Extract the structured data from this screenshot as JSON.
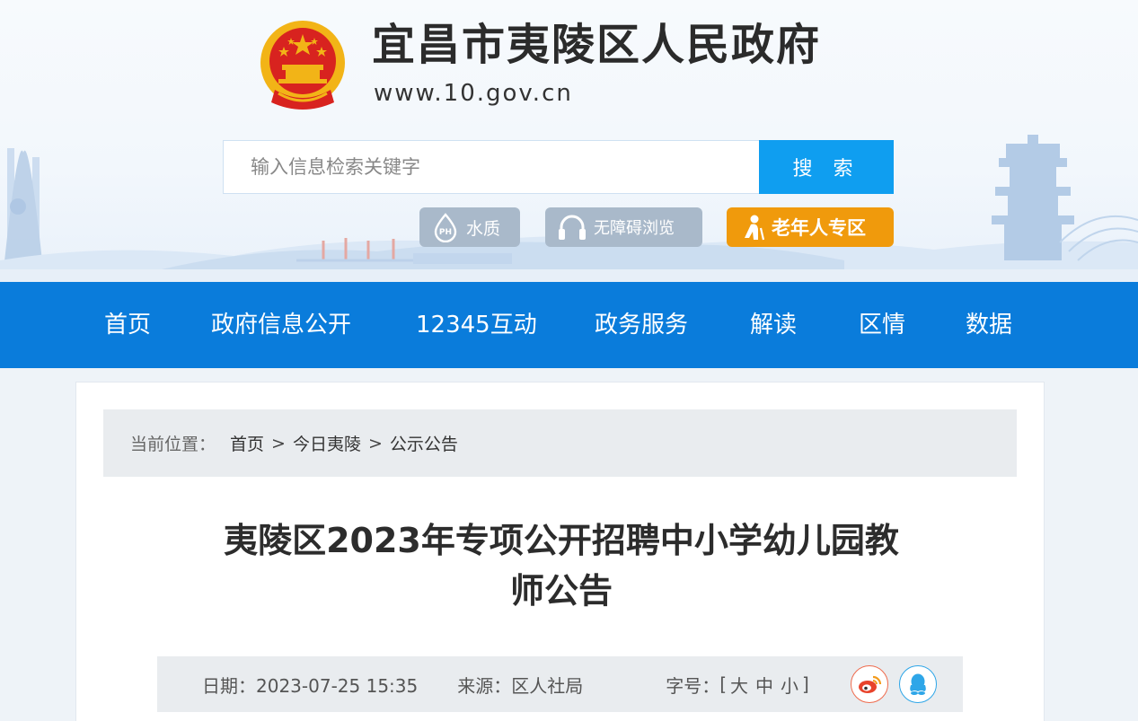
{
  "header": {
    "site_title": "宜昌市夷陵区人民政府",
    "site_url": "www.10.gov.cn",
    "search": {
      "placeholder": "输入信息检索关键字",
      "button_label": "搜 索"
    },
    "quick_links": [
      {
        "label": "水质",
        "icon": "ph-water-icon"
      },
      {
        "label": "无障碍浏览",
        "icon": "headphones-icon"
      },
      {
        "label": "老年人专区",
        "icon": "elderly-person-icon"
      }
    ]
  },
  "nav": {
    "items": [
      {
        "label": "首页"
      },
      {
        "label": "政府信息公开"
      },
      {
        "label": "12345互动"
      },
      {
        "label": "政务服务"
      },
      {
        "label": "解读"
      },
      {
        "label": "区情"
      },
      {
        "label": "数据"
      }
    ]
  },
  "breadcrumb": {
    "prefix": "当前位置：",
    "separator": ">",
    "items": [
      "首页",
      "今日夷陵",
      "公示公告"
    ]
  },
  "article": {
    "title_line1": "夷陵区2023年专项公开招聘中小学幼儿园教",
    "title_line2": "师公告",
    "meta": {
      "date_label": "日期：",
      "date": "2023-07-25 15:35",
      "source_label": "来源：",
      "source": "区人社局",
      "fontsize_label": "字号：",
      "fontsize_open": "[",
      "fontsize_options": [
        "大",
        "中",
        "小"
      ],
      "fontsize_close": "]",
      "share_icons": [
        "weibo-icon",
        "qq-icon"
      ]
    }
  },
  "colors": {
    "nav_bg": "#0a7cdb",
    "search_button": "#0f9ef0",
    "elder_button": "#f09a0c",
    "quick_button_gray": "#a9b9ca",
    "emblem_red": "#d8231f",
    "emblem_gold": "#f2b417"
  }
}
